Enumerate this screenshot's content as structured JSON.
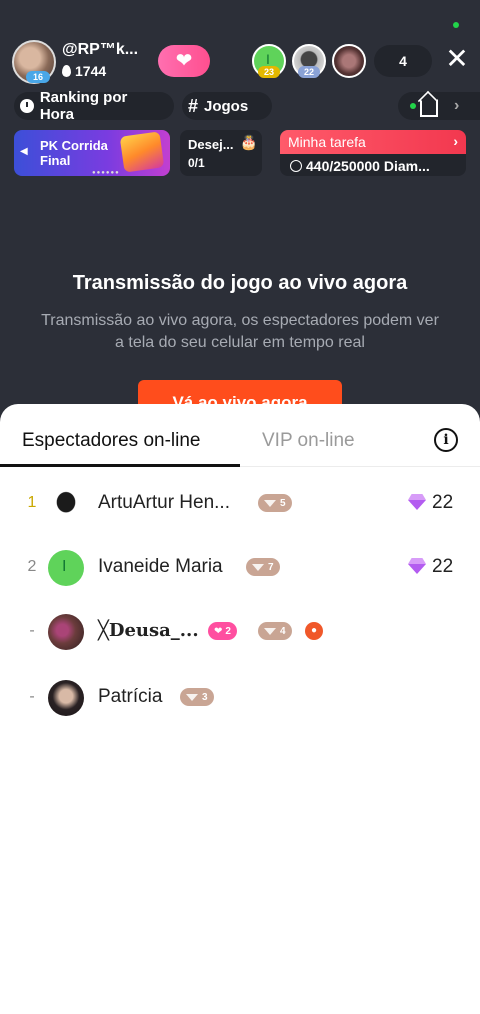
{
  "header": {
    "host_name": "@RP™k...",
    "host_level": "16",
    "host_fans": "1744",
    "viewer_badges": [
      "23",
      "22"
    ],
    "viewer_initial": "I",
    "viewer_count": "4",
    "close_symbol": "✕"
  },
  "chips": {
    "ranking": "Ranking por Hora",
    "games": "Jogos",
    "games_symbol": "#"
  },
  "cards": {
    "pk_title": "PK Corrida Final",
    "wish_title": "Desej...",
    "wish_count": "0/1",
    "task_title": "Minha tarefa",
    "task_progress": "440/250000 Diam..."
  },
  "stream": {
    "heading": "Transmissão do jogo ao vivo agora",
    "subtext": "Transmissão ao vivo agora, os espectadores podem ver a tela do seu celular em tempo real",
    "button_label": "Vá ao vivo agora"
  },
  "sheet": {
    "tab_viewers": "Espectadores on-line",
    "tab_vip": "VIP on-line",
    "info_symbol": "i",
    "viewers": [
      {
        "rank": "1",
        "name": "ArtuArtur Hen...",
        "level": "5",
        "score": "22"
      },
      {
        "rank": "2",
        "name": "Ivaneide Maria",
        "initial": "I",
        "level": "7",
        "score": "22"
      },
      {
        "rank": "-",
        "name": "╳Deusa_...",
        "hearts": "2",
        "level": "4"
      },
      {
        "rank": "-",
        "name": "Patrícia",
        "level": "3"
      }
    ]
  },
  "colors": {
    "accent_orange": "#ff4d1c",
    "follow_pink": "#ff4f8f",
    "task_red": "#f2384f",
    "gem_purple": "#b35cf0",
    "level_badge": "#c9a594"
  },
  "icons": [
    "clock-icon",
    "home-icon",
    "heart-icon",
    "gem-icon",
    "info-icon",
    "close-icon",
    "flame-icon"
  ]
}
